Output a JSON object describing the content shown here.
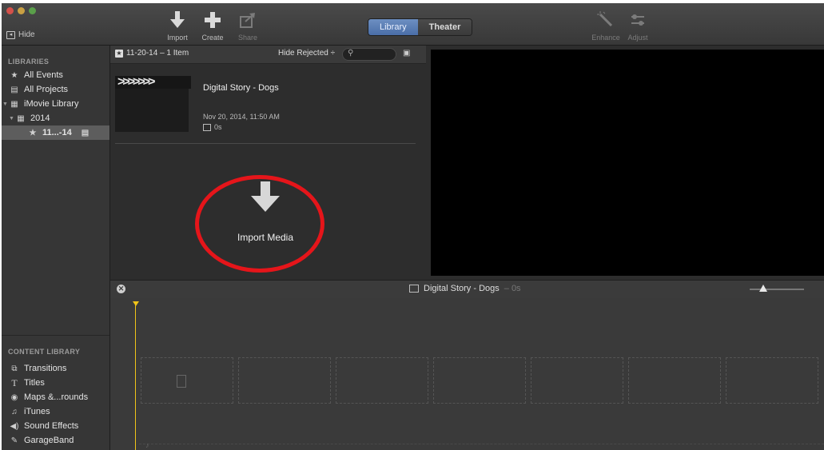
{
  "toolbar": {
    "hide_label": "Hide",
    "import_label": "Import",
    "create_label": "Create",
    "share_label": "Share",
    "tabs": [
      "Library",
      "Theater"
    ],
    "enhance_label": "Enhance",
    "adjust_label": "Adjust"
  },
  "sidebar": {
    "libraries_title": "LIBRARIES",
    "items": [
      {
        "label": "All Events",
        "icon": "star-box-icon"
      },
      {
        "label": "All Projects",
        "icon": "clapboard-icon"
      },
      {
        "label": "iMovie Library",
        "icon": "grid-icon"
      },
      {
        "label": "2014",
        "icon": "calendar-icon"
      },
      {
        "label": "11...-14",
        "icon": "star-box-icon"
      }
    ],
    "content_title": "CONTENT LIBRARY",
    "content_items": [
      {
        "label": "Transitions",
        "icon": "transitions-icon"
      },
      {
        "label": "Titles",
        "icon": "titles-icon"
      },
      {
        "label": "Maps &...rounds",
        "icon": "globe-icon"
      },
      {
        "label": "iTunes",
        "icon": "music-note-icon"
      },
      {
        "label": "Sound Effects",
        "icon": "speaker-icon"
      },
      {
        "label": "GarageBand",
        "icon": "guitar-icon"
      }
    ]
  },
  "browser": {
    "event_label": "11-20-14 – 1 Item",
    "filter_label": "Hide Rejected ÷",
    "project": {
      "title": "Digital Story - Dogs",
      "date": "Nov 20, 2014, 11:50 AM",
      "duration": "0s"
    },
    "import_media_label": "Import Media"
  },
  "timeline": {
    "title": "Digital Story - Dogs",
    "duration": "– 0s"
  },
  "colors": {
    "accent_tab": "#5b7fb6",
    "highlight_ring": "#e5151a",
    "playhead": "#f0c419"
  }
}
